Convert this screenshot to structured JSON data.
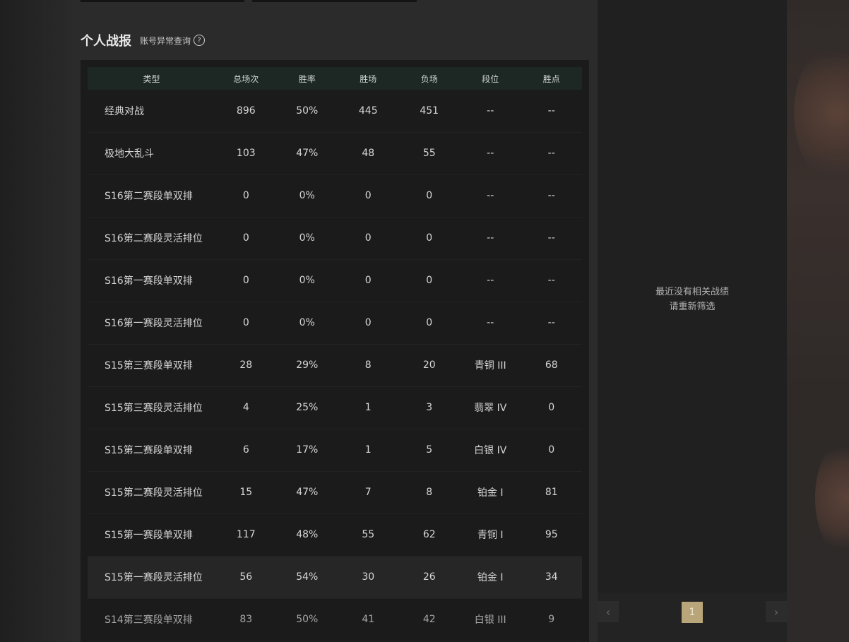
{
  "section": {
    "title": "个人战报",
    "subtitle": "账号异常查询",
    "help_icon": "?"
  },
  "table": {
    "headers": [
      "类型",
      "总场次",
      "胜率",
      "胜场",
      "负场",
      "段位",
      "胜点"
    ],
    "rows": [
      [
        "经典对战",
        "896",
        "50%",
        "445",
        "451",
        "--",
        "--"
      ],
      [
        "极地大乱斗",
        "103",
        "47%",
        "48",
        "55",
        "--",
        "--"
      ],
      [
        "S16第二赛段单双排",
        "0",
        "0%",
        "0",
        "0",
        "--",
        "--"
      ],
      [
        "S16第二赛段灵活排位",
        "0",
        "0%",
        "0",
        "0",
        "--",
        "--"
      ],
      [
        "S16第一赛段单双排",
        "0",
        "0%",
        "0",
        "0",
        "--",
        "--"
      ],
      [
        "S16第一赛段灵活排位",
        "0",
        "0%",
        "0",
        "0",
        "--",
        "--"
      ],
      [
        "S15第三赛段单双排",
        "28",
        "29%",
        "8",
        "20",
        "青铜 III",
        "68"
      ],
      [
        "S15第三赛段灵活排位",
        "4",
        "25%",
        "1",
        "3",
        "翡翠 IV",
        "0"
      ],
      [
        "S15第二赛段单双排",
        "6",
        "17%",
        "1",
        "5",
        "白银 IV",
        "0"
      ],
      [
        "S15第二赛段灵活排位",
        "15",
        "47%",
        "7",
        "8",
        "铂金 I",
        "81"
      ],
      [
        "S15第一赛段单双排",
        "117",
        "48%",
        "55",
        "62",
        "青铜 I",
        "95"
      ],
      [
        "S15第一赛段灵活排位",
        "56",
        "54%",
        "30",
        "26",
        "铂金 I",
        "34"
      ],
      [
        "S14第三赛段单双排",
        "83",
        "50%",
        "41",
        "42",
        "白银 III",
        "9"
      ]
    ]
  },
  "right_panel": {
    "empty_line1": "最近没有相关战绩",
    "empty_line2": "请重新筛选"
  },
  "pager": {
    "prev": "‹",
    "current_page": "1",
    "next": "›"
  }
}
